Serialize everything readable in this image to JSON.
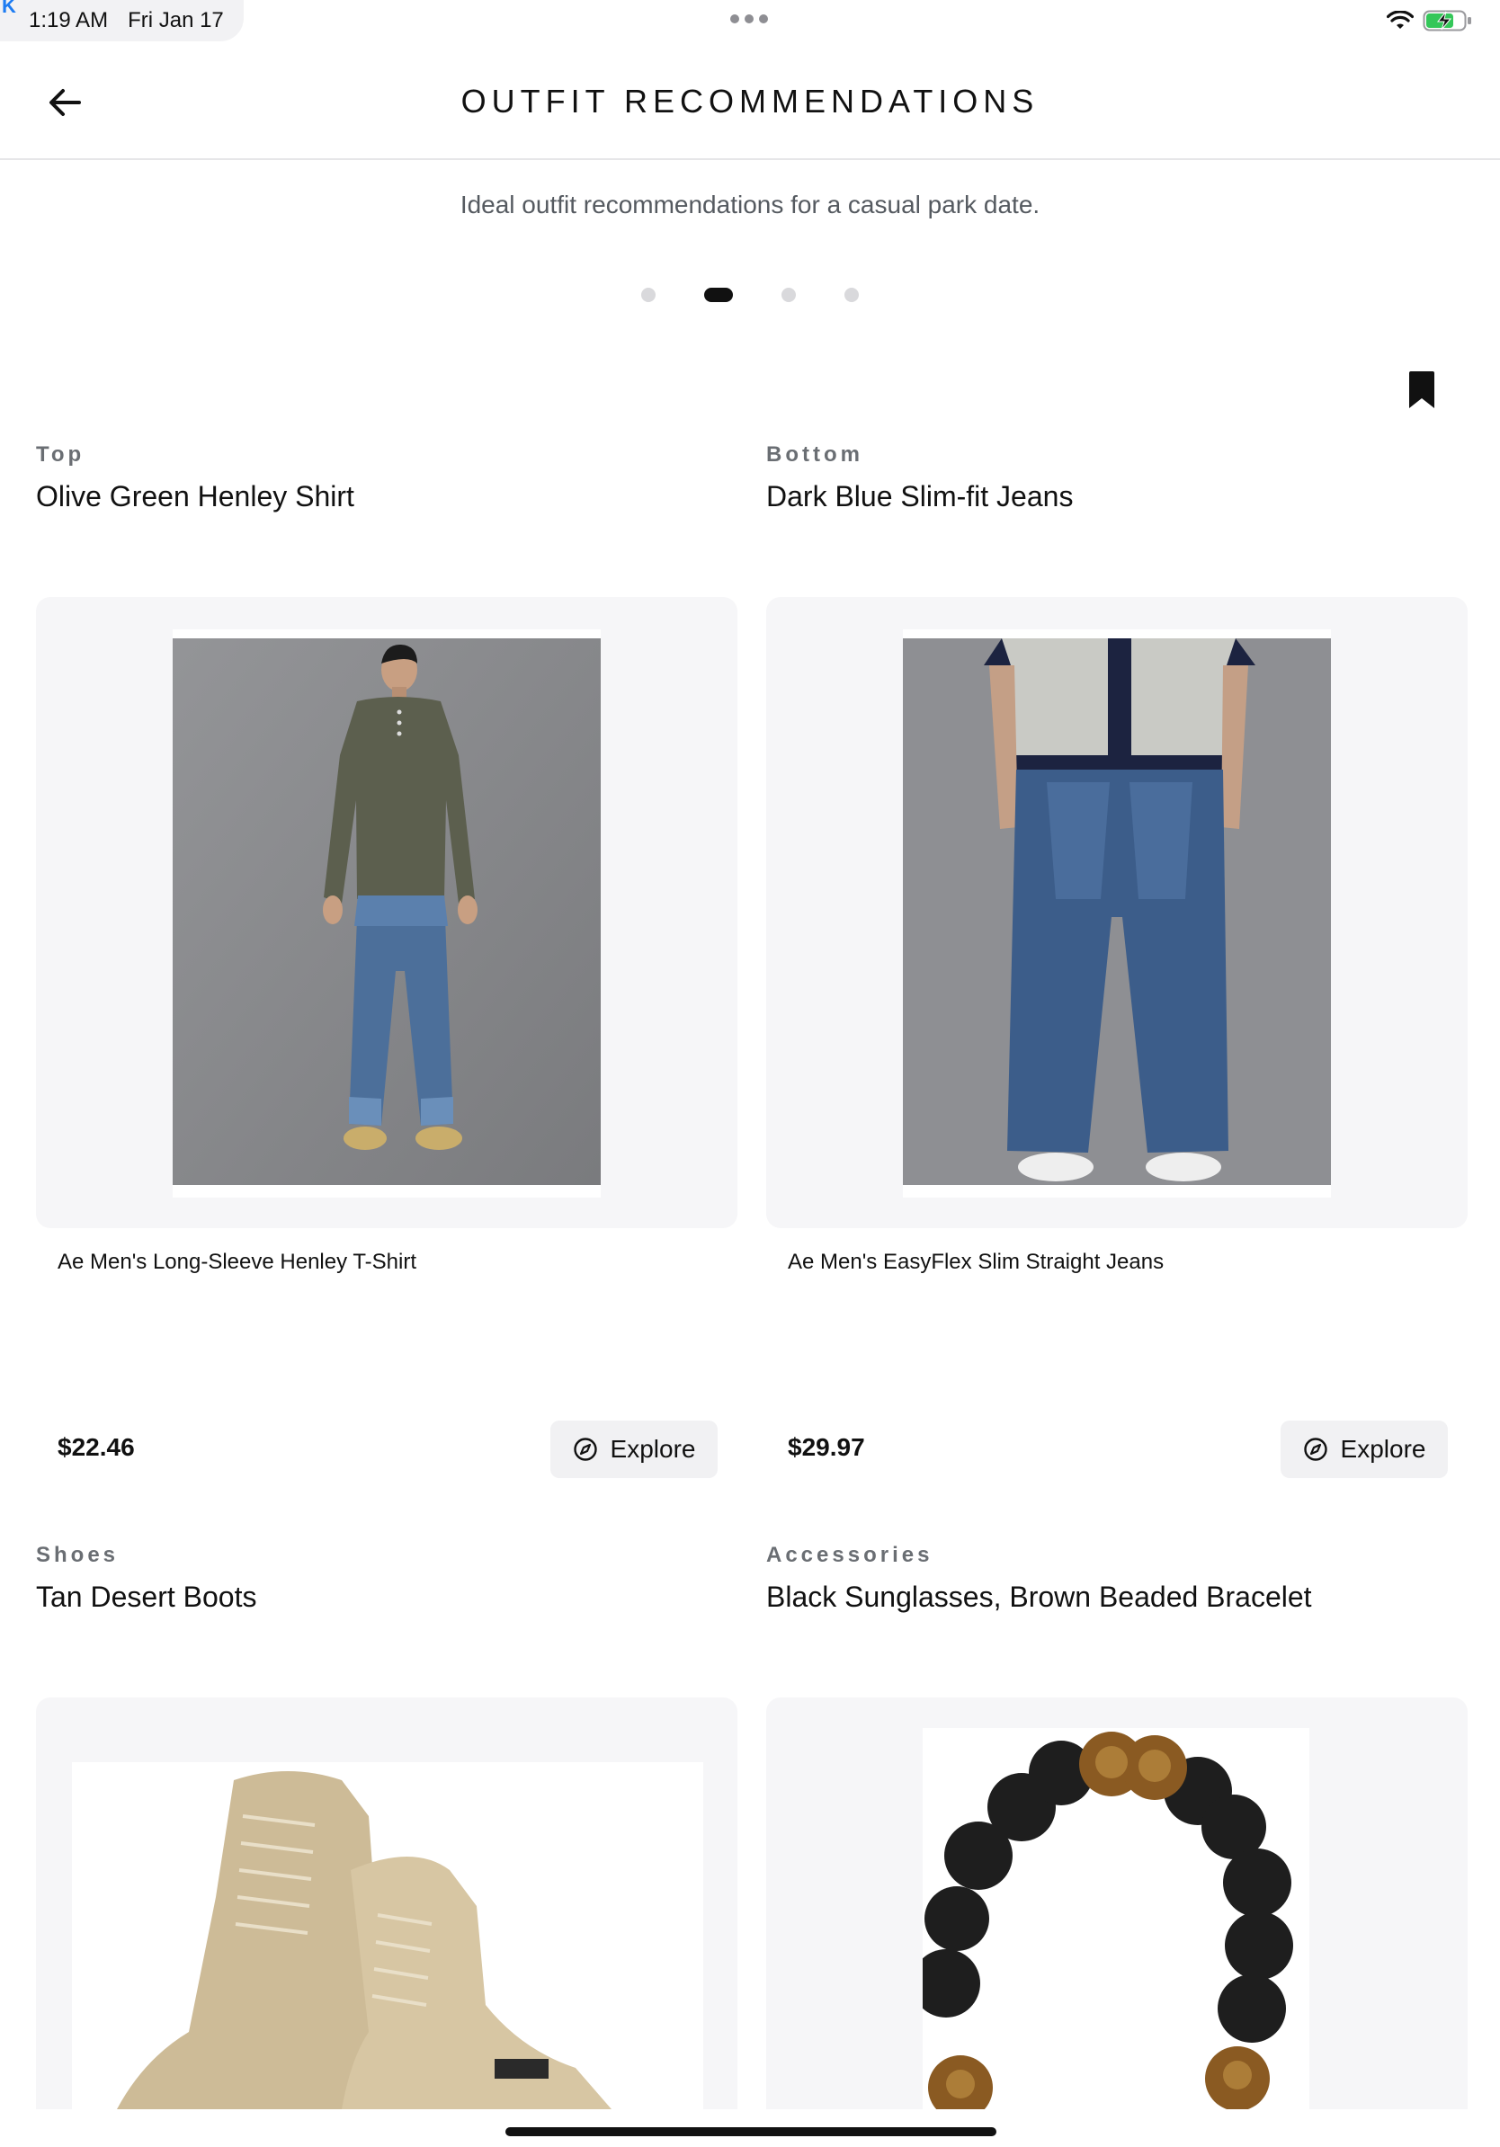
{
  "status_bar": {
    "back_app_letter": "K",
    "time": "1:19 AM",
    "date": "Fri Jan 17",
    "wifi_icon": "wifi-icon",
    "battery_icon": "battery-charging-icon",
    "battery_color": "#34c759"
  },
  "nav": {
    "back_icon": "arrow-left-icon",
    "title": "OUTFIT RECOMMENDATIONS"
  },
  "subtitle": "Ideal outfit recommendations for a casual park date.",
  "pager": {
    "count": 4,
    "active_index": 1
  },
  "bookmark_icon": "bookmark-icon",
  "items": [
    {
      "category": "Top",
      "name": "Olive Green Henley Shirt",
      "product_title": "Ae Men's Long-Sleeve Henley T-Shirt",
      "price": "$22.46",
      "explore_label": "Explore",
      "explore_icon": "compass-icon"
    },
    {
      "category": "Bottom",
      "name": "Dark Blue Slim-fit Jeans",
      "product_title": "Ae Men's EasyFlex Slim Straight Jeans",
      "price": "$29.97",
      "explore_label": "Explore",
      "explore_icon": "compass-icon"
    },
    {
      "category": "Shoes",
      "name": "Tan Desert Boots"
    },
    {
      "category": "Accessories",
      "name": "Black Sunglasses, Brown Beaded Bracelet"
    }
  ],
  "colors": {
    "accent": "#111111",
    "card_bg": "#f6f6f8",
    "muted_text": "#6a6e73"
  }
}
